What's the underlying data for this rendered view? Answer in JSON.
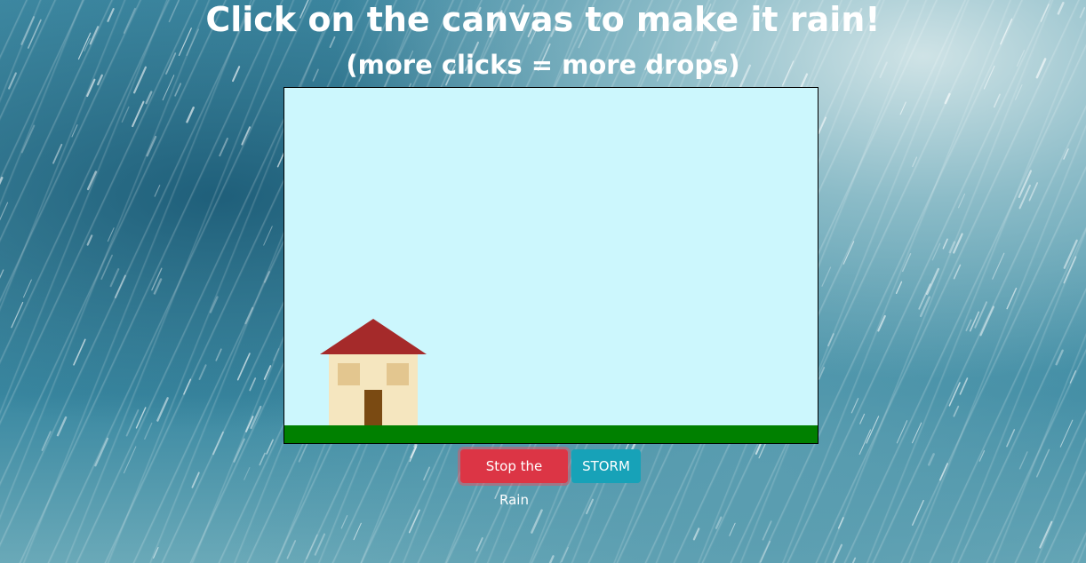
{
  "header": {
    "title": "Click on the canvas to make it rain!",
    "subtitle": "(more clicks = more drops)"
  },
  "canvas": {
    "background_color": "#ccf7fd",
    "ground_color": "#008000",
    "house": {
      "roof_color": "#a52a2a",
      "wall_color": "#f5e6bf",
      "window_color": "#e3c68f",
      "door_color": "#7a4a12"
    }
  },
  "controls": {
    "stop_label": "Stop the Rain",
    "stop_color": "#dc3545",
    "storm_label": "STORM",
    "storm_color": "#17a2b8"
  }
}
